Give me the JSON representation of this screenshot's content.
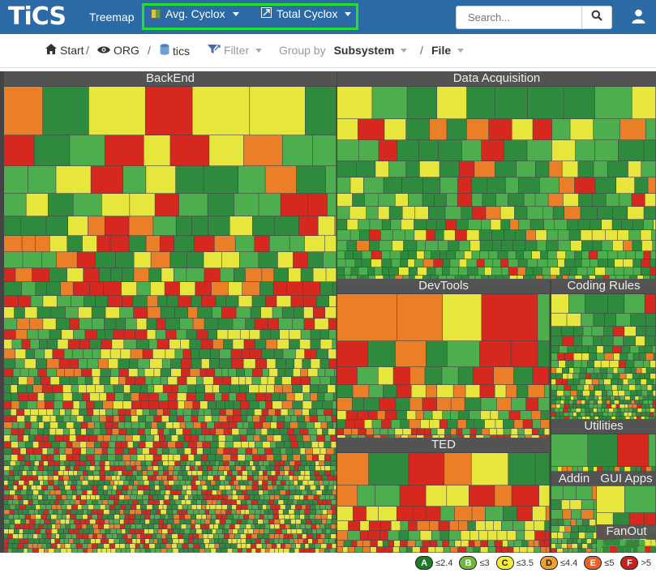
{
  "header": {
    "logo": "TiCS",
    "app_title": "Treemap",
    "color_metric": "Avg. Cyclox",
    "size_metric": "Total Cyclox",
    "search_placeholder": "Search..."
  },
  "breadcrumb": {
    "start": "Start",
    "org": "ORG",
    "project": "tics",
    "filter": "Filter",
    "group_by_label": "Group by",
    "group_by_value": "Subsystem",
    "level": "File",
    "separator": "/"
  },
  "treemap": {
    "groups": [
      {
        "label": "BackEnd",
        "palette": "mixed"
      },
      {
        "label": "Data Acquisition",
        "palette": "greenish"
      },
      {
        "label": "DevTools",
        "palette": "warm"
      },
      {
        "label": "Coding Rules",
        "palette": "greenish"
      },
      {
        "label": "Utilities",
        "palette": "mixed"
      },
      {
        "label": "TED",
        "palette": "warm"
      },
      {
        "label": "Addin",
        "palette": "greenish"
      },
      {
        "label": "GUI Apps",
        "palette": "mixed"
      },
      {
        "label": "FanOut",
        "palette": "greenish"
      }
    ]
  },
  "legend": [
    {
      "grade": "A",
      "range": "≤2.4",
      "color": "#1f7a2a",
      "text_color": "#ffffff"
    },
    {
      "grade": "B",
      "range": "≤3",
      "color": "#6fb83a",
      "text_color": "#ffffff"
    },
    {
      "grade": "C",
      "range": "≤3.5",
      "color": "#f4f03a",
      "text_color": "#222222"
    },
    {
      "grade": "D",
      "range": "≤4.4",
      "color": "#f0a030",
      "text_color": "#222222"
    },
    {
      "grade": "E",
      "range": "≤5",
      "color": "#e8622a",
      "text_color": "#ffffff"
    },
    {
      "grade": "F",
      "range": ">5",
      "color": "#c8211c",
      "text_color": "#ffffff"
    }
  ],
  "colors": {
    "header_bg": "#2c6aa6",
    "highlight_border": "#23e02c",
    "dark_green": "#2e8b3e",
    "green": "#4cae4c",
    "yellow": "#e6e63c",
    "orange": "#ea7f28",
    "red": "#d6281e"
  }
}
